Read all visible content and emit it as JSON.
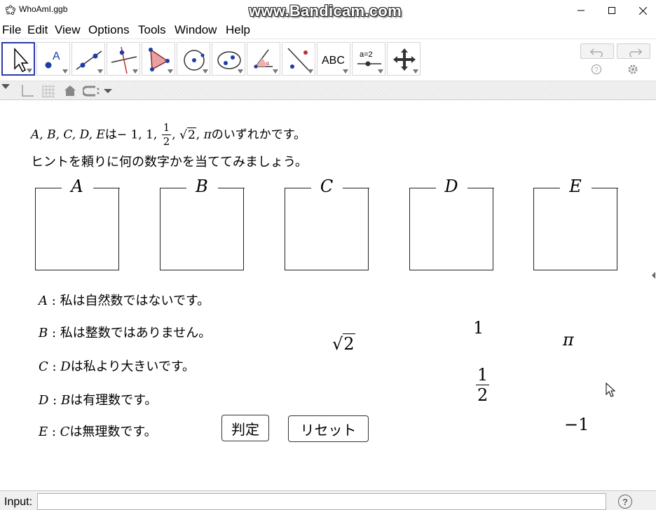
{
  "window": {
    "title": "WhoAmI.ggb",
    "watermark": "www.Bandicam.com"
  },
  "menu": [
    "File",
    "Edit",
    "View",
    "Options",
    "Tools",
    "Window",
    "Help"
  ],
  "toolbar": {
    "tools": [
      "move-tool-icon",
      "point-tool-icon",
      "line-tool-icon",
      "perpendicular-line-tool-icon",
      "polygon-tool-icon",
      "circle-tool-icon",
      "ellipse-tool-icon",
      "angle-tool-icon",
      "reflect-tool-icon",
      "text-tool-icon",
      "slider-tool-icon",
      "move-graphics-view-icon"
    ],
    "text_tool_label": "ABC",
    "slider_tool_label": "a=2"
  },
  "graphics": {
    "intro_letters": "A, B, C, D, E",
    "intro_ha": "は",
    "intro_numbers": "− 1, 1, ",
    "intro_frac_num": "1",
    "intro_frac_den": "2",
    "intro_sqrt": "2",
    "intro_pi": "π",
    "intro_tail": "のいずれかです。",
    "intro_line2": "ヒントを頼りに何の数字かを当ててみましょう。",
    "boxes": [
      "A",
      "B",
      "C",
      "D",
      "E"
    ],
    "hints": [
      {
        "letter": "A",
        "sep": " : ",
        "text": "私は自然数ではないです。"
      },
      {
        "letter": "B",
        "sep": " : ",
        "text": "私は整数ではありません。"
      },
      {
        "letter": "C",
        "sep": " : ",
        "letter2": "D",
        "text": "は私より大きいです。"
      },
      {
        "letter": "D",
        "sep": " : ",
        "letter2": "B",
        "text": "は有理数です。"
      },
      {
        "letter": "E",
        "sep": " : ",
        "letter2": "C",
        "text": "は無理数です。"
      }
    ],
    "cards": {
      "one": "1",
      "pi": "π",
      "sqrt_radicand": "2",
      "half_num": "1",
      "half_den": "2",
      "minus_one": "−1"
    },
    "judge_button": "判定",
    "reset_button": "リセット"
  },
  "inputbar": {
    "label": "Input:",
    "value": "",
    "help": "?"
  }
}
